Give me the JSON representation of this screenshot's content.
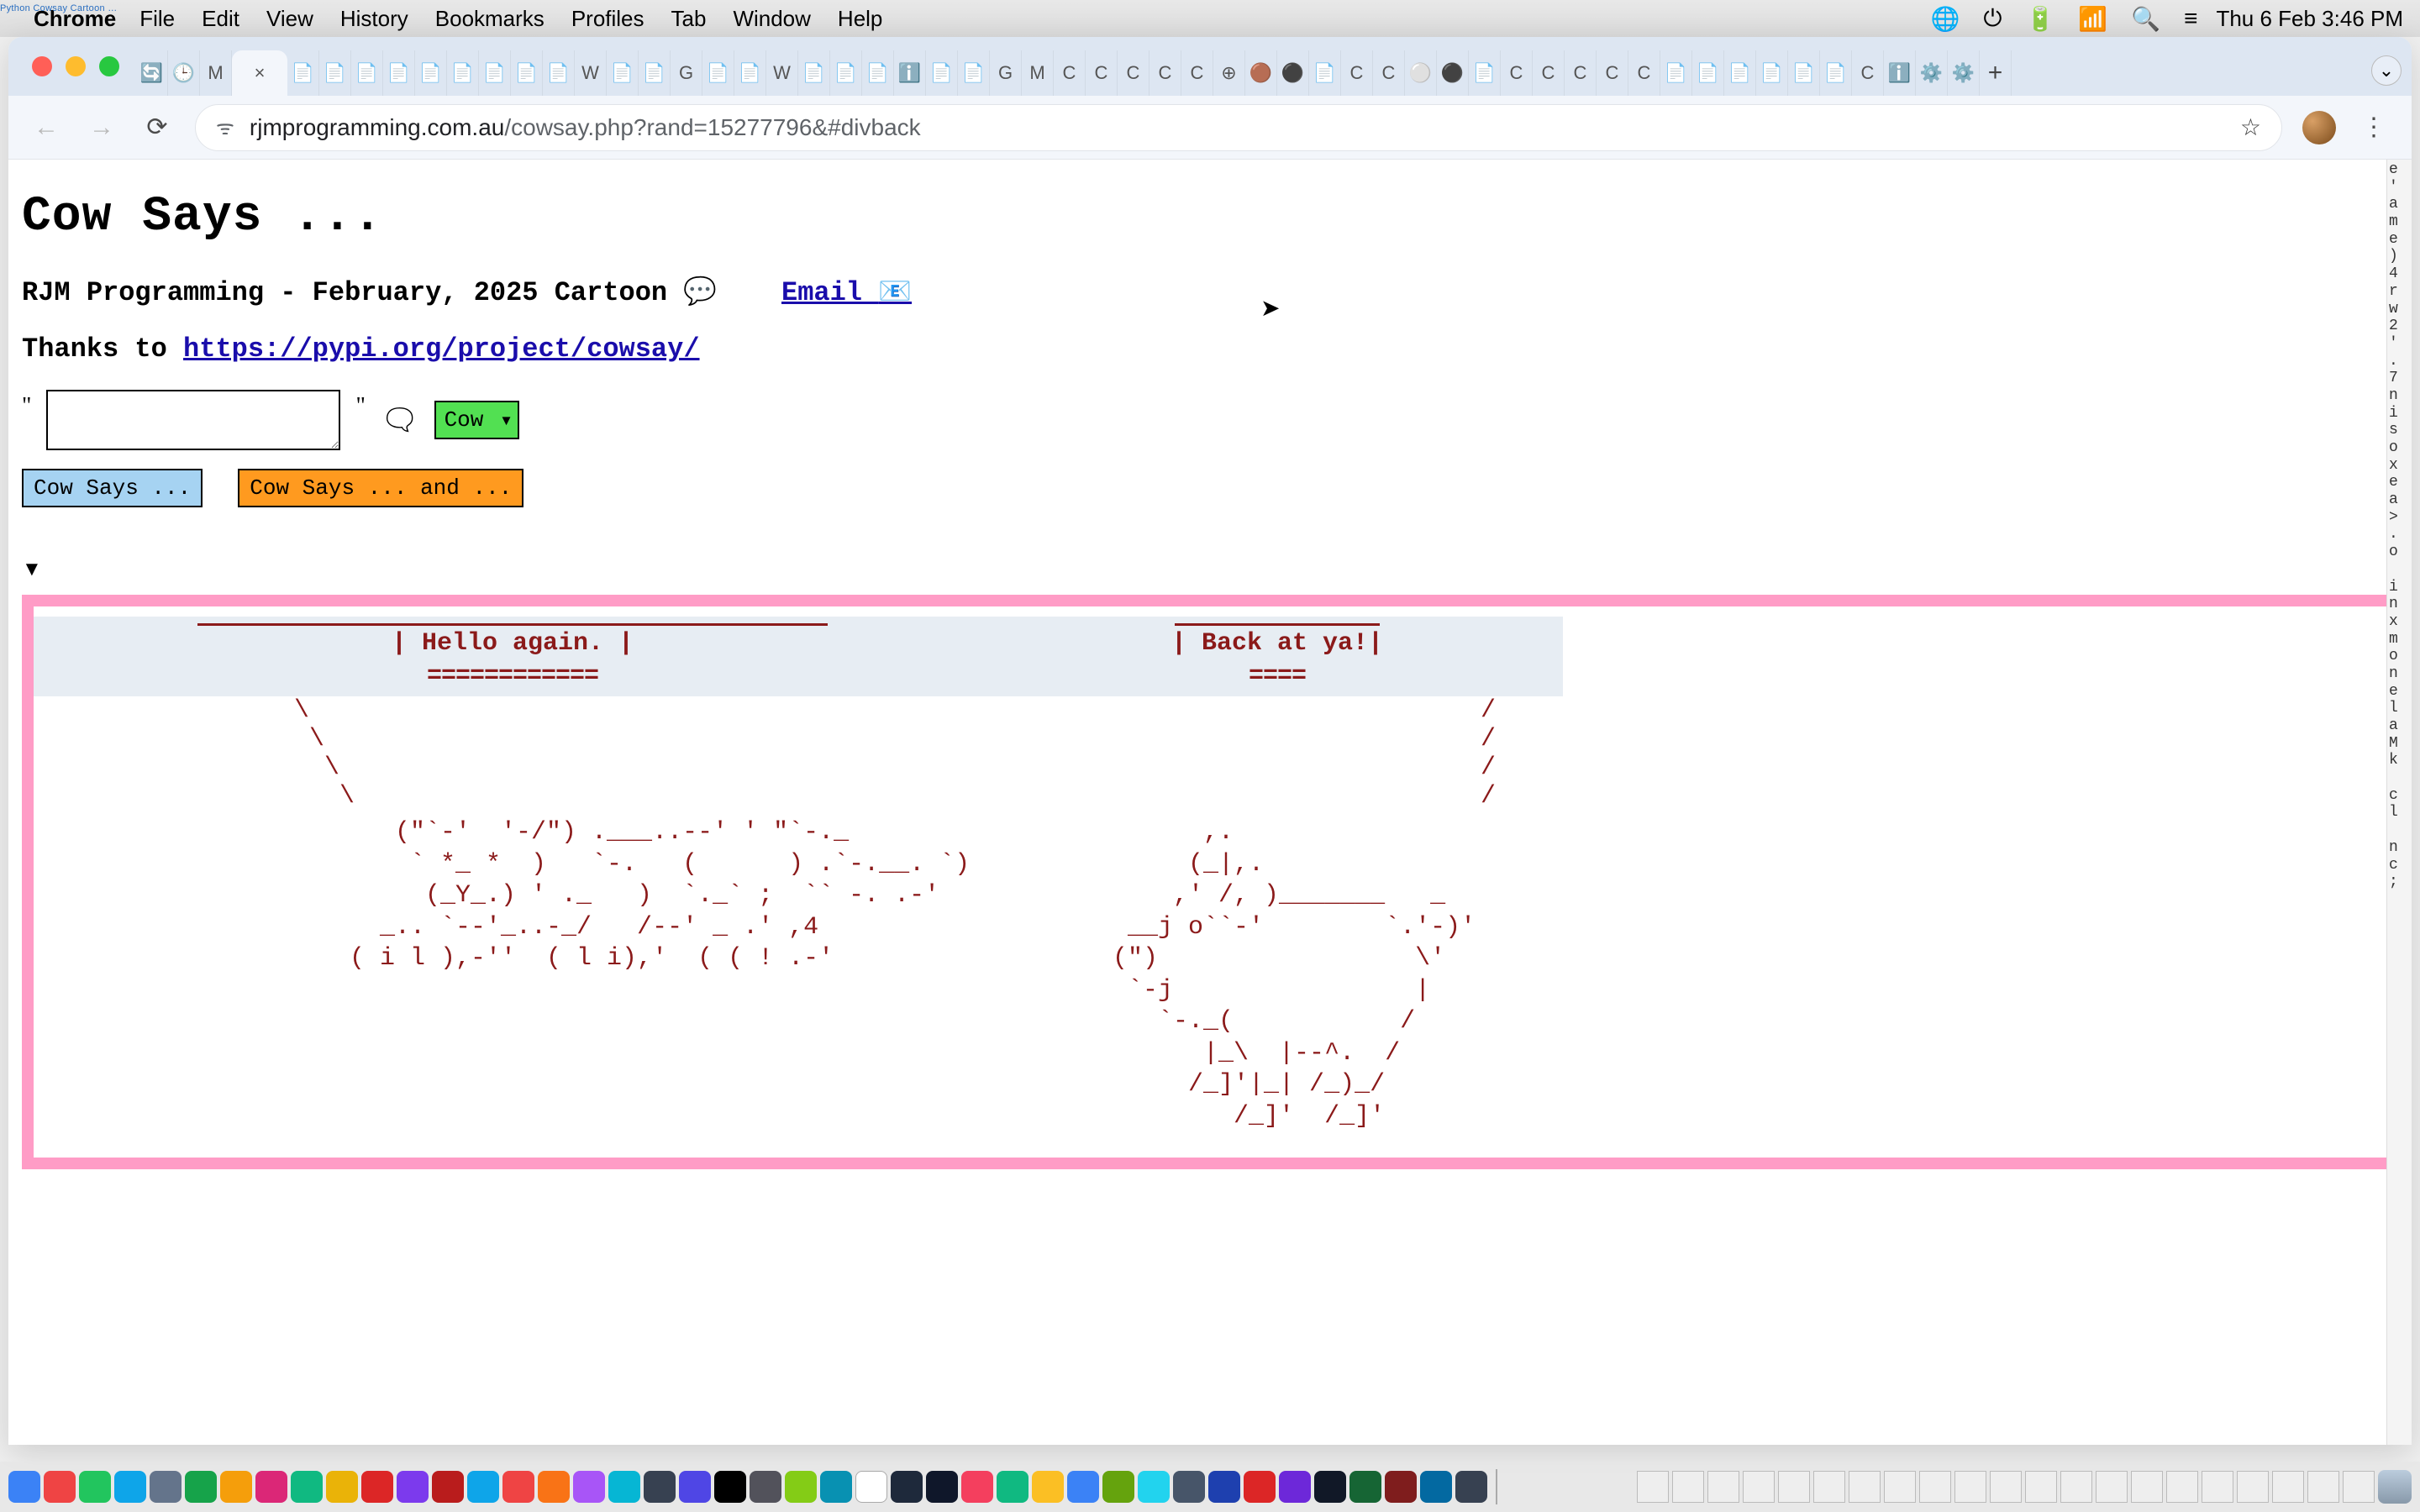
{
  "menubar": {
    "app": "Chrome",
    "items": [
      "File",
      "Edit",
      "View",
      "History",
      "Bookmarks",
      "Profiles",
      "Tab",
      "Window",
      "Help"
    ],
    "clock": "Thu 6 Feb  3:46 PM",
    "tiny_overlay": "Python Cowsay Cartoon …"
  },
  "browser": {
    "url_host": "rjmprogramming.com.au",
    "url_path": "/cowsay.php?rand=15277796&#divback",
    "tab_close": "×",
    "plus": "+"
  },
  "page": {
    "title": "Cow Says ...",
    "byline_prefix": "RJM Programming - February, 2025 Cartoon ",
    "byline_bubble": "💬",
    "email_label": "Email",
    "email_icon": "📧",
    "thanks_prefix": "Thanks to ",
    "thanks_link": "https://pypi.org/project/cowsay/",
    "quote_open": "\"",
    "quote_close": "\"",
    "textarea_value": "",
    "speech_icon": "🗨",
    "select_value": "Cow",
    "btn1": "Cow Says ...",
    "btn2": "Cow Says ... and ...",
    "disclosure": "▼",
    "bubble_left_text": "| Hello again. |",
    "bubble_left_under": "============",
    "bubble_right_text": "| Back at ya!|",
    "bubble_right_under": "====",
    "tail_left": "\\\n \\\n  \\\n   \\",
    "tail_right": "   /\n  /\n /\n/",
    "art_left": "     (\"`-'  '-/\") .___..--' ' \"`-._\n      ` *_ *  )   `-.   (      ) .`-.__. `)\n       (_Y_.) ' ._   )  `._` ;  `` -. .-'\n    _.. `--'_..-_/   /--' _ .' ,4\n  ( i l ),-''  ( l i),'  ( ( ! .-'",
    "art_right": "              ,.\n             (_|,.\n            ,' /, )_______   _\n         __j o``-'        `.'-)'\n        (\")                 \\'\n         `-j                |\n           `-._(           /\n              |_\\  |--^.  /\n             /_]'|_| /_)_/\n                /_]'  /_]'",
    "codestrip": "e\n'\na\nm\ne\n)\n4\nr\nw\n2\n'\n.\n7\nn\ni\ns\no\nx\ne\na\n>\n.\no\n\ni\nn\nx\nm\no\nn\ne\nl\na\nM\nk\n\nc\nl\n\nn\nc\n;"
  }
}
